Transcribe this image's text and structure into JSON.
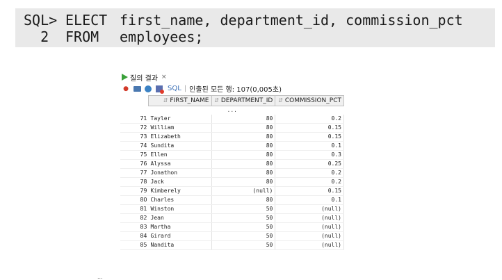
{
  "sql": {
    "line1": {
      "prompt": "SQL>",
      "keyword": "ELECT",
      "text": "first_name, department_id, commission_pct"
    },
    "line2": {
      "prompt": "  2",
      "keyword": "FROM",
      "text": "employees;"
    }
  },
  "panel": {
    "tab_label": "질의 결과",
    "tab_close": "×",
    "toolbar": {
      "icons": [
        "pin-icon",
        "print-icon",
        "refresh-icon",
        "cancel-icon"
      ],
      "sql_label": "SQL",
      "separator": "|",
      "status": "인출된 모든 행: 107(0,005초)"
    },
    "columns": [
      "FIRST_NAME",
      "DEPARTMENT_ID",
      "COMMISSION_PCT"
    ],
    "ellipsis": "...",
    "rows": [
      {
        "n": "71",
        "first_name": "Tayler",
        "department_id": "80",
        "commission_pct": "0.2"
      },
      {
        "n": "72",
        "first_name": "William",
        "department_id": "80",
        "commission_pct": "0.15"
      },
      {
        "n": "73",
        "first_name": "Elizabeth",
        "department_id": "80",
        "commission_pct": "0.15"
      },
      {
        "n": "74",
        "first_name": "Sundita",
        "department_id": "80",
        "commission_pct": "0.1"
      },
      {
        "n": "75",
        "first_name": "Ellen",
        "department_id": "80",
        "commission_pct": "0.3"
      },
      {
        "n": "76",
        "first_name": "Alyssa",
        "department_id": "80",
        "commission_pct": "0.25"
      },
      {
        "n": "77",
        "first_name": "Jonathon",
        "department_id": "80",
        "commission_pct": "0.2"
      },
      {
        "n": "78",
        "first_name": "Jack",
        "department_id": "80",
        "commission_pct": "0.2"
      },
      {
        "n": "79",
        "first_name": "Kimberely",
        "department_id": "(null)",
        "commission_pct": "0.15"
      },
      {
        "n": "80",
        "first_name": "Charles",
        "department_id": "80",
        "commission_pct": "0.1"
      },
      {
        "n": "81",
        "first_name": "Winston",
        "department_id": "50",
        "commission_pct": "(null)"
      },
      {
        "n": "82",
        "first_name": "Jean",
        "department_id": "50",
        "commission_pct": "(null)"
      },
      {
        "n": "83",
        "first_name": "Martha",
        "department_id": "50",
        "commission_pct": "(null)"
      },
      {
        "n": "84",
        "first_name": "Girard",
        "department_id": "50",
        "commission_pct": "(null)"
      },
      {
        "n": "85",
        "first_name": "Nandita",
        "department_id": "50",
        "commission_pct": "(null)"
      }
    ]
  }
}
